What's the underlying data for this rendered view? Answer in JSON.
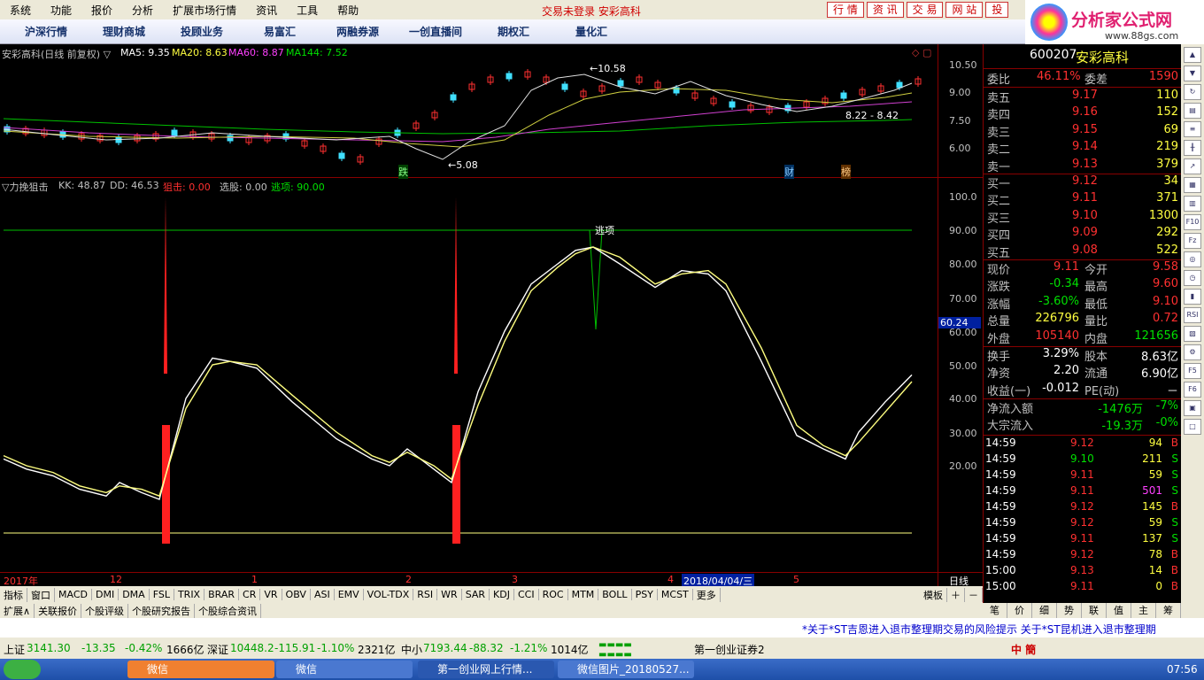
{
  "menu": {
    "items": [
      "系统",
      "功能",
      "报价",
      "分析",
      "扩展市场行情",
      "资讯",
      "工具",
      "帮助"
    ],
    "center": "交易未登录  安彩高科",
    "right_buttons": [
      "行 情",
      "资 讯",
      "交 易",
      "网 站",
      "投"
    ]
  },
  "logo": {
    "title": "分析家公式网",
    "sub": "www.88gs.com"
  },
  "nav": [
    "沪深行情",
    "理财商城",
    "投顾业务",
    "易富汇",
    "两融券源",
    "一创直播间",
    "期权汇",
    "量化汇"
  ],
  "upper": {
    "title": "安彩高科(日线 前复权) ▽",
    "ma": [
      {
        "label": "MA5: 9.35",
        "color": "#ffffff"
      },
      {
        "label": "MA20: 8.63",
        "color": "#ffff40"
      },
      {
        "label": "MA60: 8.87",
        "color": "#ff40ff"
      },
      {
        "label": "MA144: 7.52",
        "color": "#00e000"
      }
    ],
    "yticks": [
      "10.50",
      "9.00",
      "7.50",
      "6.00"
    ],
    "annotations": {
      "high": "10.58",
      "low": "5.08",
      "range": "8.22 - 8.42",
      "die": "跌",
      "cai": "财",
      "bang": "榜"
    }
  },
  "lower": {
    "title": "▽力挽狙击",
    "values": [
      {
        "label": "KK: 48.87",
        "color": "#c0c0c0"
      },
      {
        "label": "DD: 46.53",
        "color": "#c0c0c0"
      },
      {
        "label": "狙击: 0.00",
        "color": "#ff3030"
      },
      {
        "label": "选股: 0.00",
        "color": "#c0c0c0"
      },
      {
        "label": "逃项: 90.00",
        "color": "#00e000"
      }
    ],
    "yticks": [
      "100.0",
      "90.00",
      "80.00",
      "70.00",
      "60.00",
      "50.00",
      "40.00",
      "30.00",
      "20.00"
    ],
    "cursor_value": "60.24",
    "escape_label": "逃项",
    "escape_line": 90,
    "base_line": 0
  },
  "chart_data": {
    "type": "line",
    "series": [
      {
        "name": "KK",
        "values": [
          22,
          19,
          17,
          13,
          11,
          15,
          12,
          10,
          40,
          52,
          51,
          49,
          39,
          28,
          22,
          20,
          25,
          19,
          15,
          42,
          60,
          74,
          80,
          84,
          85,
          80,
          73,
          78,
          77,
          72,
          51,
          29,
          25,
          22,
          30,
          39,
          47
        ]
      },
      {
        "name": "DD",
        "values": [
          23,
          20,
          18,
          14,
          12,
          14,
          13,
          11,
          37,
          50,
          51,
          50,
          41,
          30,
          23,
          21,
          24,
          20,
          16,
          38,
          57,
          72,
          79,
          83,
          85,
          82,
          74,
          77,
          78,
          74,
          55,
          32,
          26,
          23,
          27,
          36,
          45
        ]
      }
    ],
    "ylim": [
      0,
      100
    ]
  },
  "timeaxis": [
    "2017年",
    "12",
    "1",
    "2",
    "3",
    "4",
    "2018/04/04/三",
    "5",
    "日线"
  ],
  "quote": {
    "code": "600207",
    "name": "安彩高科",
    "weibi_label": "委比",
    "weibi": "46.11%",
    "weicha_label": "委差",
    "weicha": "1590",
    "asks": [
      {
        "label": "卖五",
        "price": "9.17",
        "vol": "110"
      },
      {
        "label": "卖四",
        "price": "9.16",
        "vol": "152"
      },
      {
        "label": "卖三",
        "price": "9.15",
        "vol": "69"
      },
      {
        "label": "卖二",
        "price": "9.14",
        "vol": "219"
      },
      {
        "label": "卖一",
        "price": "9.13",
        "vol": "379"
      }
    ],
    "bids": [
      {
        "label": "买一",
        "price": "9.12",
        "vol": "34"
      },
      {
        "label": "买二",
        "price": "9.11",
        "vol": "371"
      },
      {
        "label": "买三",
        "price": "9.10",
        "vol": "1300"
      },
      {
        "label": "买四",
        "price": "9.09",
        "vol": "292"
      },
      {
        "label": "买五",
        "price": "9.08",
        "vol": "522"
      }
    ],
    "stats": [
      [
        "现价",
        "9.11",
        "今开",
        "9.58"
      ],
      [
        "涨跌",
        "-0.34",
        "最高",
        "9.60"
      ],
      [
        "涨幅",
        "-3.60%",
        "最低",
        "9.10"
      ],
      [
        "总量",
        "226796",
        "量比",
        "0.72"
      ],
      [
        "外盘",
        "105140",
        "内盘",
        "121656"
      ]
    ],
    "stats2": [
      [
        "换手",
        "3.29%",
        "股本",
        "8.63亿"
      ],
      [
        "净资",
        "2.20",
        "流通",
        "6.90亿"
      ],
      [
        "收益(一)",
        "-0.012",
        "PE(动)",
        "－"
      ]
    ],
    "flow": [
      [
        "净流入额",
        "-1476万",
        "-7%"
      ],
      [
        "大宗流入",
        "-19.3万",
        "-0%"
      ]
    ],
    "ticks": [
      [
        "14:59",
        "9.12",
        "94",
        "B"
      ],
      [
        "14:59",
        "9.10",
        "211",
        "S"
      ],
      [
        "14:59",
        "9.11",
        "59",
        "S"
      ],
      [
        "14:59",
        "9.11",
        "501",
        "S"
      ],
      [
        "14:59",
        "9.12",
        "145",
        "B"
      ],
      [
        "14:59",
        "9.12",
        "59",
        "S"
      ],
      [
        "14:59",
        "9.11",
        "137",
        "S"
      ],
      [
        "14:59",
        "9.12",
        "78",
        "B"
      ],
      [
        "15:00",
        "9.13",
        "14",
        "B"
      ],
      [
        "15:00",
        "9.11",
        "0",
        "B"
      ]
    ]
  },
  "indicator_tabs": [
    "指标",
    "窗口",
    "MACD",
    "DMI",
    "DMA",
    "FSL",
    "TRIX",
    "BRAR",
    "CR",
    "VR",
    "OBV",
    "ASI",
    "EMV",
    "VOL-TDX",
    "RSI",
    "WR",
    "SAR",
    "KDJ",
    "CCI",
    "ROC",
    "MTM",
    "BOLL",
    "PSY",
    "MCST",
    "更多"
  ],
  "template_label": "模板",
  "bottom_tabs": [
    "扩展∧",
    "关联报价",
    "个股评级",
    "个股研究报告",
    "个股综合资讯"
  ],
  "right_tabs": [
    "笔",
    "价",
    "细",
    "势",
    "联",
    "值",
    "主",
    "筹"
  ],
  "ticker": "*关于*ST吉恩进入退市整理期交易的风险提示      关于*ST昆机进入退市整理期",
  "status": [
    {
      "name": "上证",
      "value": "3141.30",
      "chg": "-13.35",
      "pct": "-0.42%",
      "amt": "1666亿"
    },
    {
      "name": "深证",
      "value": "10448.2",
      "chg": "-115.91",
      "pct": "-1.10%",
      "amt": "2321亿"
    },
    {
      "name": "中小",
      "value": "7193.44",
      "chg": "-88.32",
      "pct": "-1.21%",
      "amt": "1014亿"
    }
  ],
  "broker": "第一创业证券2",
  "ime": "中 簡",
  "taskbar": {
    "tasks": [
      "微信",
      "微信",
      "第一创业网上行情...",
      "微信图片_20180527..."
    ],
    "time": "07:56"
  }
}
